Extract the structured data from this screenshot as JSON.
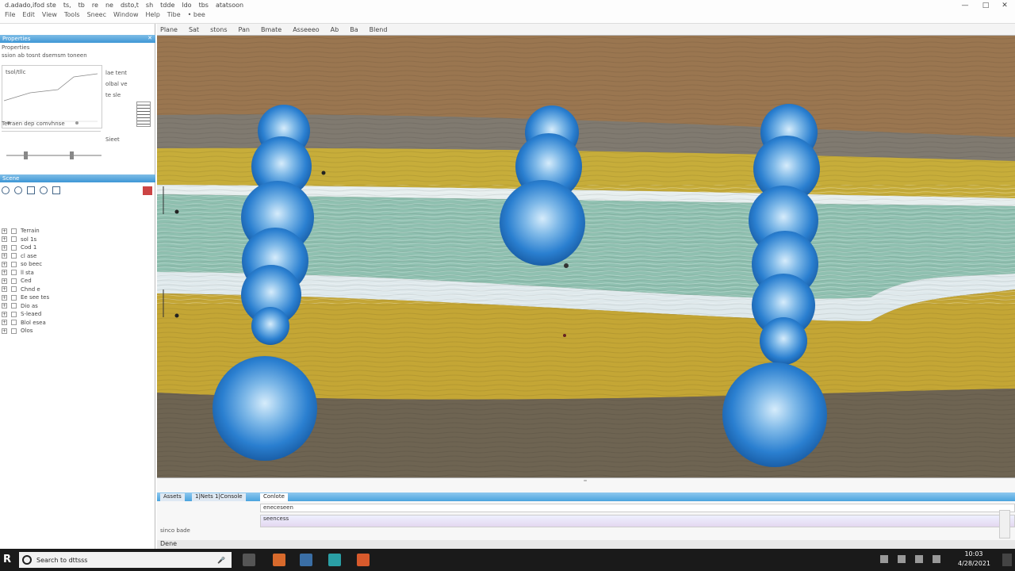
{
  "titlebar": {
    "menu_row1": [
      "d.adado,ifod ste",
      "ts,",
      "tb",
      "re",
      "ne",
      "dsto,t",
      "sh",
      "tdde",
      "ldo",
      "tbs",
      "atatsoon"
    ],
    "menu_row2": [
      "File",
      "Edit",
      "View",
      "Tools",
      "Sneec",
      "Window",
      "Help",
      "Tibe",
      "• bee"
    ],
    "min_label": "—",
    "max_label": "□",
    "close_label": "✕"
  },
  "viewport_toolbar": {
    "items": [
      "Plane",
      "Sat",
      "stons",
      "Pan",
      "Bmate",
      "Asseeeo",
      "Ab",
      "Ba",
      "Blend"
    ]
  },
  "left_panel": {
    "header1": "Properties",
    "row1": "Properties",
    "row2": "ssion ab tosnt dsemsm toneen",
    "side_labels": [
      "lae tent",
      "olbal ve",
      "te sle"
    ],
    "chart_label": "tsol/tllc",
    "row3": "Terraen dep comvhnse",
    "row4": "Sieet",
    "header2": "Scene",
    "tree_items": [
      "Terrain",
      "sol 1s",
      "Cod 1",
      "cl ase",
      "so beec",
      "ll sta",
      "Ced",
      "Chnd e",
      "Ee see tes",
      "Dio as",
      "S-leaed",
      "Blol esea",
      "Olos"
    ]
  },
  "bottom_panel": {
    "tab1": "Assets",
    "tab2": "1|Nets 1|Console",
    "tab3": "Conlote",
    "line1": "eneceseen",
    "line2": "seencess",
    "side_text": "sinco bade",
    "status": "Dene"
  },
  "taskbar": {
    "search_placeholder": "Search to dttsss",
    "clock_time": "10:03",
    "clock_date": "4/28/2021"
  },
  "colors": {
    "sphere_blue": "#2a7fd0",
    "panel_header": "#3e97d6",
    "layer_yellow": "#c7ad3a",
    "layer_teal": "#8fc0b0",
    "layer_brown": "#8a6a48"
  }
}
